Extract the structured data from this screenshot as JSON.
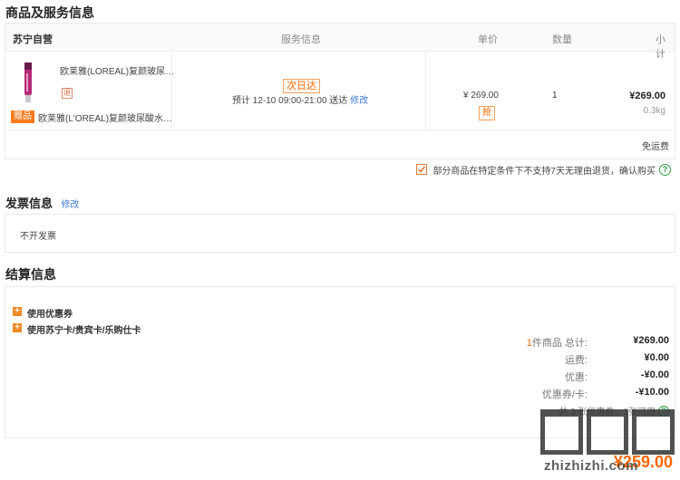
{
  "section_goods": {
    "title": "商品及服务信息"
  },
  "table_header": {
    "shop": "苏宁自营",
    "service": "服务信息",
    "unit_price": "单价",
    "quantity": "数量",
    "subtotal": "小计"
  },
  "product": {
    "name": "欧莱雅(LOREAL)复颜玻尿…",
    "service_tag": "次日达",
    "delivery_text": "预计 12-10 09:00-21:00  送达",
    "modify": "修改",
    "price": "¥ 269.00",
    "price_tag": "抢",
    "quantity": "1",
    "subtotal": "¥269.00",
    "weight": "0.3kg",
    "return_icon_text": "退"
  },
  "gift": {
    "tag": "赠品",
    "name": "欧莱雅(L'OREAL)复颜玻尿酸水…"
  },
  "shipping_note": "免运费",
  "return_policy": {
    "text": "部分商品在特定条件下不支持7天无理由退货，确认购买",
    "help": "?"
  },
  "invoice": {
    "title": "发票信息",
    "modify": "修改",
    "value": "不开发票"
  },
  "settlement": {
    "title": "结算信息",
    "coupon": "使用优惠券",
    "card": "使用苏宁卡/贵宾卡/乐购仕卡",
    "count": "1",
    "total_label": "件商品  总计:",
    "total": "¥269.00",
    "freight_label": "运费:",
    "freight": "¥0.00",
    "discount_label": "优惠:",
    "discount": "-¥0.00",
    "coupon_label": "优惠券/卡:",
    "coupon_value": "-¥10.00",
    "coupon_note": "共 3 张优惠券，1张可用",
    "coupon_help": "?",
    "pay_amount": "¥259.00"
  },
  "watermark": "zhizhizhi.com",
  "colors": {
    "accent": "#ff6600",
    "link": "#3a7bd5",
    "check": "#2ea043"
  }
}
